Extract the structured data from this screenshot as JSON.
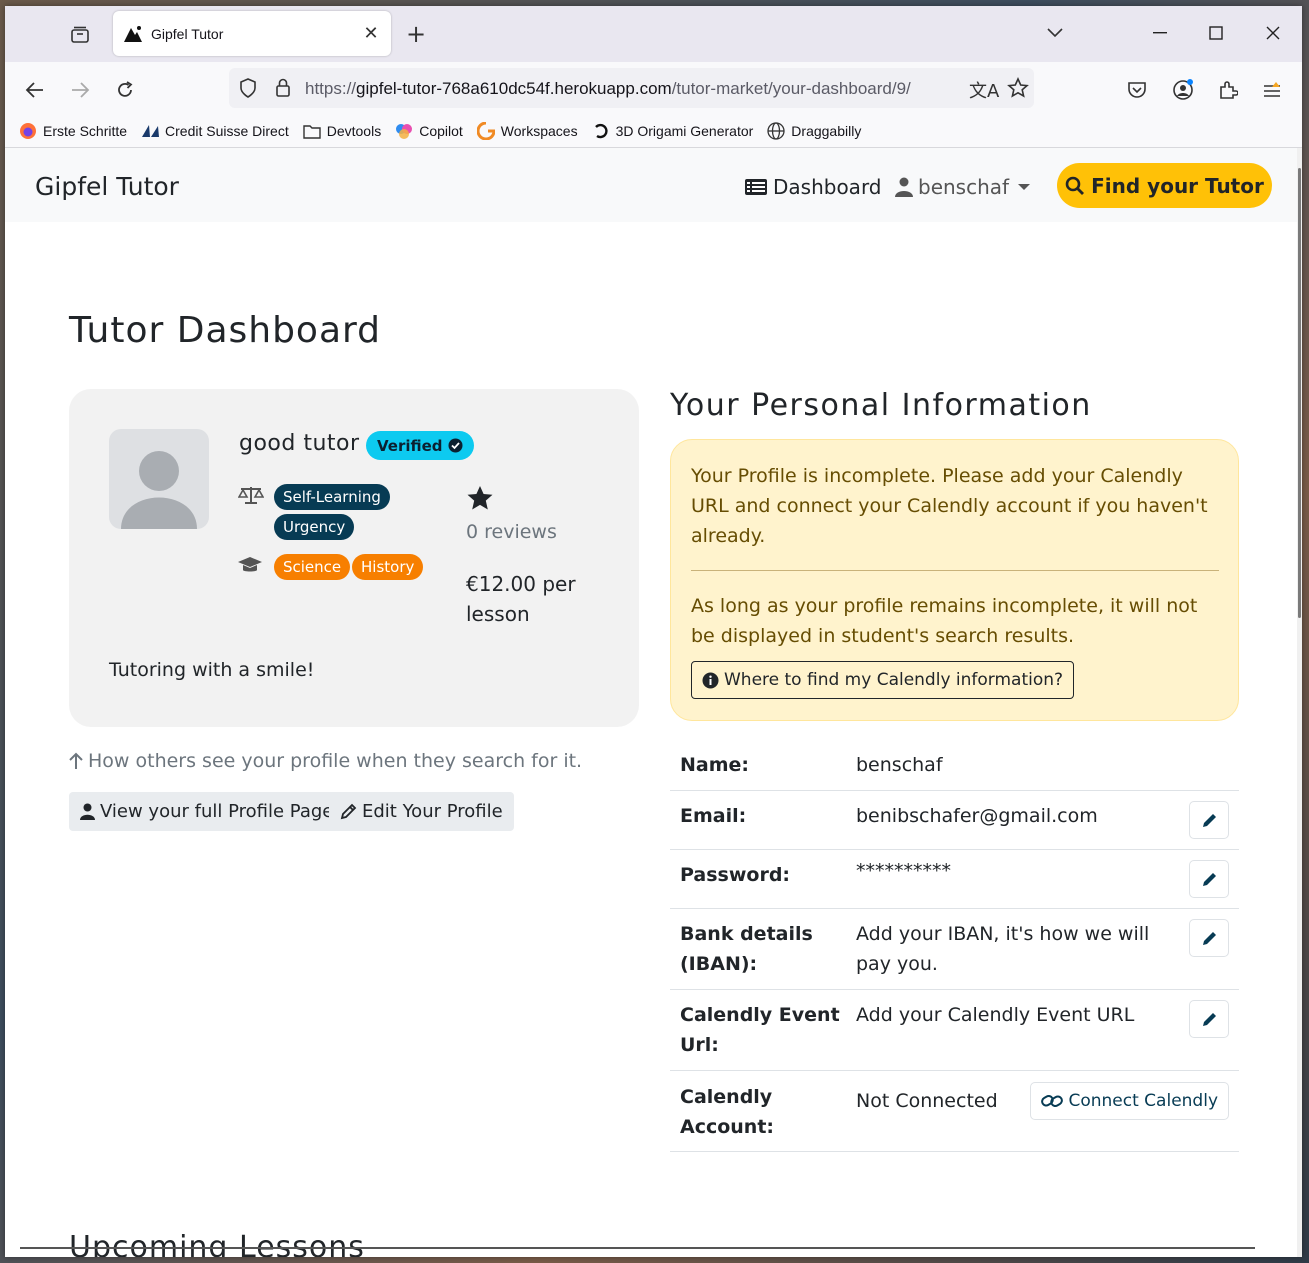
{
  "browser": {
    "tab_title": "Gipfel Tutor",
    "url_scheme": "https://",
    "url_host": "gipfel-tutor-768a610dc54f.herokuapp.com",
    "url_path": "/tutor-market/your-dashboard/9/",
    "bookmarks": [
      "Erste Schritte",
      "Credit Suisse Direct",
      "Devtools",
      "Copilot",
      "Workspaces",
      "3D Origami Generator",
      "Draggabilly"
    ]
  },
  "site_nav": {
    "brand": "Gipfel Tutor",
    "dashboard": "Dashboard",
    "username": "benschaf",
    "find_tutor": "Find your Tutor"
  },
  "page_title": "Tutor Dashboard",
  "profile_card": {
    "name": "good tutor",
    "verified": "Verified",
    "learning_tags": [
      "Self-Learning",
      "Urgency"
    ],
    "subject_tags": [
      "Science",
      "History"
    ],
    "reviews": "0 reviews",
    "price": "€12.00 per lesson",
    "bio": "Tutoring with a smile!"
  },
  "profile_hint": "How others see your profile when they search for it.",
  "buttons": {
    "view_profile": "View your full Profile Page",
    "edit_profile": "Edit Your Profile"
  },
  "personal_info": {
    "title": "Your Personal Information",
    "alert_p1": "Your Profile is incomplete. Please add your Calendly URL and connect your Calendly account if you haven't already.",
    "alert_p2": "As long as your profile remains incomplete, it will not be displayed in student's search results.",
    "alert_button": "Where to find my Calendly information?",
    "rows": [
      {
        "label": "Name:",
        "value": "benschaf"
      },
      {
        "label": "Email:",
        "value": "benibschafer@gmail.com"
      },
      {
        "label": "Password:",
        "value": "**********"
      },
      {
        "label": "Bank details (IBAN):",
        "value": "Add your IBAN, it's how we will pay you."
      },
      {
        "label": "Calendly Event Url:",
        "value": "Add your Calendly Event URL"
      },
      {
        "label": "Calendly Account:",
        "value": "Not Connected"
      }
    ],
    "connect_calendly": "Connect Calendly"
  },
  "upcoming_title": "Upcoming Lessons",
  "colors": {
    "accent": "#ffc107",
    "verified": "#0dcaf0",
    "tag_dark": "#073b54",
    "tag_orange": "#f77f00",
    "alert_bg": "#fff3cd"
  }
}
